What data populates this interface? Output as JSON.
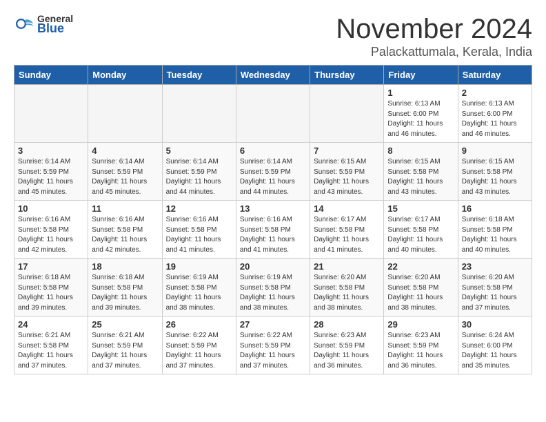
{
  "logo": {
    "general": "General",
    "blue": "Blue"
  },
  "header": {
    "month": "November 2024",
    "location": "Palackattumala, Kerala, India"
  },
  "weekdays": [
    "Sunday",
    "Monday",
    "Tuesday",
    "Wednesday",
    "Thursday",
    "Friday",
    "Saturday"
  ],
  "weeks": [
    [
      {
        "day": "",
        "info": ""
      },
      {
        "day": "",
        "info": ""
      },
      {
        "day": "",
        "info": ""
      },
      {
        "day": "",
        "info": ""
      },
      {
        "day": "",
        "info": ""
      },
      {
        "day": "1",
        "info": "Sunrise: 6:13 AM\nSunset: 6:00 PM\nDaylight: 11 hours\nand 46 minutes."
      },
      {
        "day": "2",
        "info": "Sunrise: 6:13 AM\nSunset: 6:00 PM\nDaylight: 11 hours\nand 46 minutes."
      }
    ],
    [
      {
        "day": "3",
        "info": "Sunrise: 6:14 AM\nSunset: 5:59 PM\nDaylight: 11 hours\nand 45 minutes."
      },
      {
        "day": "4",
        "info": "Sunrise: 6:14 AM\nSunset: 5:59 PM\nDaylight: 11 hours\nand 45 minutes."
      },
      {
        "day": "5",
        "info": "Sunrise: 6:14 AM\nSunset: 5:59 PM\nDaylight: 11 hours\nand 44 minutes."
      },
      {
        "day": "6",
        "info": "Sunrise: 6:14 AM\nSunset: 5:59 PM\nDaylight: 11 hours\nand 44 minutes."
      },
      {
        "day": "7",
        "info": "Sunrise: 6:15 AM\nSunset: 5:59 PM\nDaylight: 11 hours\nand 43 minutes."
      },
      {
        "day": "8",
        "info": "Sunrise: 6:15 AM\nSunset: 5:58 PM\nDaylight: 11 hours\nand 43 minutes."
      },
      {
        "day": "9",
        "info": "Sunrise: 6:15 AM\nSunset: 5:58 PM\nDaylight: 11 hours\nand 43 minutes."
      }
    ],
    [
      {
        "day": "10",
        "info": "Sunrise: 6:16 AM\nSunset: 5:58 PM\nDaylight: 11 hours\nand 42 minutes."
      },
      {
        "day": "11",
        "info": "Sunrise: 6:16 AM\nSunset: 5:58 PM\nDaylight: 11 hours\nand 42 minutes."
      },
      {
        "day": "12",
        "info": "Sunrise: 6:16 AM\nSunset: 5:58 PM\nDaylight: 11 hours\nand 41 minutes."
      },
      {
        "day": "13",
        "info": "Sunrise: 6:16 AM\nSunset: 5:58 PM\nDaylight: 11 hours\nand 41 minutes."
      },
      {
        "day": "14",
        "info": "Sunrise: 6:17 AM\nSunset: 5:58 PM\nDaylight: 11 hours\nand 41 minutes."
      },
      {
        "day": "15",
        "info": "Sunrise: 6:17 AM\nSunset: 5:58 PM\nDaylight: 11 hours\nand 40 minutes."
      },
      {
        "day": "16",
        "info": "Sunrise: 6:18 AM\nSunset: 5:58 PM\nDaylight: 11 hours\nand 40 minutes."
      }
    ],
    [
      {
        "day": "17",
        "info": "Sunrise: 6:18 AM\nSunset: 5:58 PM\nDaylight: 11 hours\nand 39 minutes."
      },
      {
        "day": "18",
        "info": "Sunrise: 6:18 AM\nSunset: 5:58 PM\nDaylight: 11 hours\nand 39 minutes."
      },
      {
        "day": "19",
        "info": "Sunrise: 6:19 AM\nSunset: 5:58 PM\nDaylight: 11 hours\nand 38 minutes."
      },
      {
        "day": "20",
        "info": "Sunrise: 6:19 AM\nSunset: 5:58 PM\nDaylight: 11 hours\nand 38 minutes."
      },
      {
        "day": "21",
        "info": "Sunrise: 6:20 AM\nSunset: 5:58 PM\nDaylight: 11 hours\nand 38 minutes."
      },
      {
        "day": "22",
        "info": "Sunrise: 6:20 AM\nSunset: 5:58 PM\nDaylight: 11 hours\nand 38 minutes."
      },
      {
        "day": "23",
        "info": "Sunrise: 6:20 AM\nSunset: 5:58 PM\nDaylight: 11 hours\nand 37 minutes."
      }
    ],
    [
      {
        "day": "24",
        "info": "Sunrise: 6:21 AM\nSunset: 5:58 PM\nDaylight: 11 hours\nand 37 minutes."
      },
      {
        "day": "25",
        "info": "Sunrise: 6:21 AM\nSunset: 5:59 PM\nDaylight: 11 hours\nand 37 minutes."
      },
      {
        "day": "26",
        "info": "Sunrise: 6:22 AM\nSunset: 5:59 PM\nDaylight: 11 hours\nand 37 minutes."
      },
      {
        "day": "27",
        "info": "Sunrise: 6:22 AM\nSunset: 5:59 PM\nDaylight: 11 hours\nand 37 minutes."
      },
      {
        "day": "28",
        "info": "Sunrise: 6:23 AM\nSunset: 5:59 PM\nDaylight: 11 hours\nand 36 minutes."
      },
      {
        "day": "29",
        "info": "Sunrise: 6:23 AM\nSunset: 5:59 PM\nDaylight: 11 hours\nand 36 minutes."
      },
      {
        "day": "30",
        "info": "Sunrise: 6:24 AM\nSunset: 6:00 PM\nDaylight: 11 hours\nand 35 minutes."
      }
    ]
  ]
}
